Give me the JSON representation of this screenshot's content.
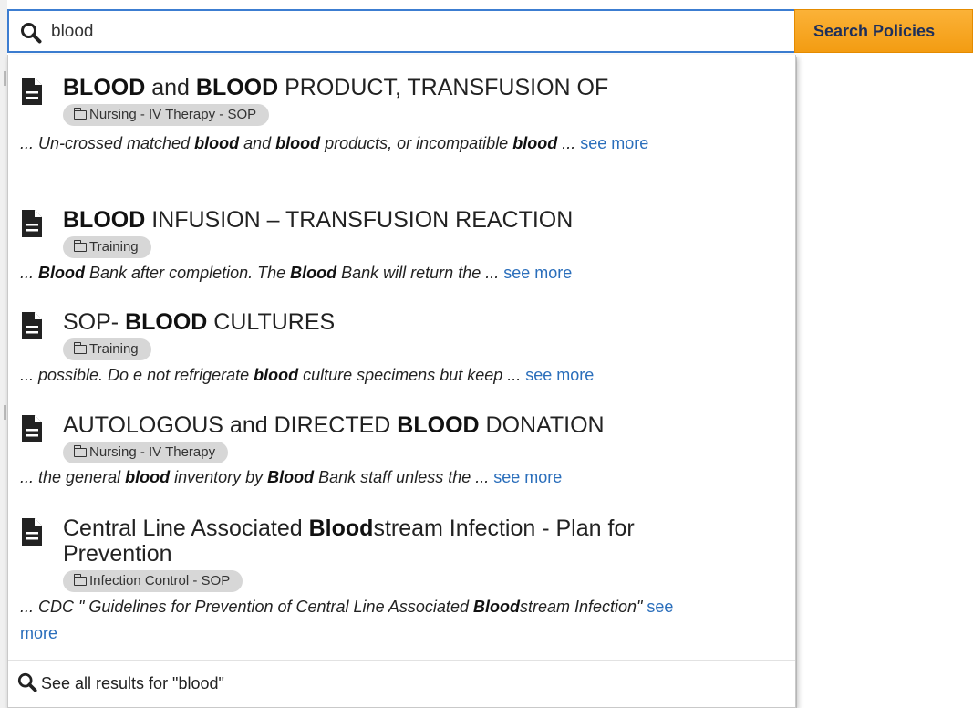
{
  "search": {
    "value": "blood",
    "button_label": "Search Policies"
  },
  "results": [
    {
      "title_parts": [
        {
          "text": "BLOOD",
          "bold": true
        },
        {
          "text": " and ",
          "bold": false
        },
        {
          "text": "BLOOD",
          "bold": true
        },
        {
          "text": " PRODUCT, TRANSFUSION OF",
          "bold": false
        }
      ],
      "category": "Nursing - IV Therapy - SOP",
      "snippet_parts": [
        {
          "text": "... Un-crossed matched ",
          "bold": false
        },
        {
          "text": "blood",
          "bold": true
        },
        {
          "text": " and ",
          "bold": false
        },
        {
          "text": "blood",
          "bold": true
        },
        {
          "text": " products, or incompatible ",
          "bold": false
        },
        {
          "text": "blood",
          "bold": true
        },
        {
          "text": " ... ",
          "bold": false
        }
      ],
      "see_more": "see more"
    },
    {
      "title_parts": [
        {
          "text": "BLOOD",
          "bold": true
        },
        {
          "text": " INFUSION – TRANSFUSION REACTION",
          "bold": false
        }
      ],
      "category": "Training",
      "snippet_parts": [
        {
          "text": "... ",
          "bold": false
        },
        {
          "text": "Blood",
          "bold": true
        },
        {
          "text": " Bank after completion. The ",
          "bold": false
        },
        {
          "text": "Blood",
          "bold": true
        },
        {
          "text": " Bank will return the ... ",
          "bold": false
        }
      ],
      "see_more": "see more"
    },
    {
      "title_parts": [
        {
          "text": "SOP- ",
          "bold": false
        },
        {
          "text": "BLOOD",
          "bold": true
        },
        {
          "text": " CULTURES",
          "bold": false
        }
      ],
      "category": "Training",
      "snippet_parts": [
        {
          "text": "... possible. Do e not refrigerate ",
          "bold": false
        },
        {
          "text": "blood",
          "bold": true
        },
        {
          "text": " culture specimens but keep ... ",
          "bold": false
        }
      ],
      "see_more": "see more"
    },
    {
      "title_parts": [
        {
          "text": "AUTOLOGOUS and DIRECTED ",
          "bold": false
        },
        {
          "text": "BLOOD",
          "bold": true
        },
        {
          "text": " DONATION",
          "bold": false
        }
      ],
      "category": "Nursing - IV Therapy",
      "snippet_parts": [
        {
          "text": "... the general ",
          "bold": false
        },
        {
          "text": "blood",
          "bold": true
        },
        {
          "text": " inventory by ",
          "bold": false
        },
        {
          "text": "Blood",
          "bold": true
        },
        {
          "text": " Bank staff unless the ... ",
          "bold": false
        }
      ],
      "see_more": "see more"
    },
    {
      "title_parts": [
        {
          "text": "Central Line Associated ",
          "bold": false
        },
        {
          "text": "Blood",
          "bold": true
        },
        {
          "text": "stream Infection - Plan for Prevention",
          "bold": false
        }
      ],
      "category": "Infection Control - SOP",
      "snippet_parts": [
        {
          "text": "... CDC \" Guidelines for Prevention of Central Line Associated ",
          "bold": false
        },
        {
          "text": "Blood",
          "bold": true
        },
        {
          "text": "stream Infection\" ",
          "bold": false
        }
      ],
      "see_more": "see more"
    }
  ],
  "see_all": "See all results for \"blood\"",
  "colors": {
    "accent_border": "#3c7dd1",
    "button": "#f39c12",
    "link": "#2a6ebb",
    "badge": "#d7d7d7"
  },
  "icons": [
    "search-icon",
    "document-icon",
    "folder-icon"
  ]
}
